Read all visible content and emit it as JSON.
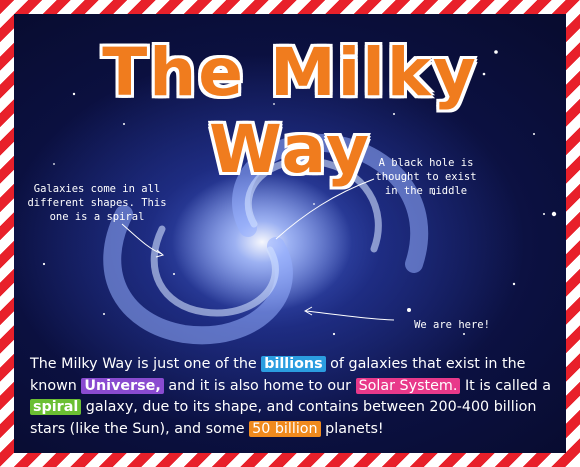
{
  "title": "The Milky Way",
  "notes": {
    "shapes": "Galaxies come in all different shapes. This one is a spiral",
    "black_hole": "A black hole is thought to exist in the middle",
    "here": "We are here!"
  },
  "body": {
    "p1": "The Milky Way is just one of the ",
    "billions": "billions",
    "p2": " of galaxies that exist in the known ",
    "universe": "Universe,",
    "p3": " and it is also home to our ",
    "solar": "Solar System.",
    "p4": " It is called a ",
    "spiral": "spiral",
    "p5": " galaxy, due to its shape, and contains between 200-400 billion stars (like the Sun), and some ",
    "fifty": "50 billion",
    "p6": " planets!"
  },
  "colors": {
    "title": "#f07c1e",
    "border_red": "#e8202a",
    "billions": "#2b9de0",
    "universe": "#8a4bd0",
    "solar": "#e8398a",
    "spiral": "#6bbf33",
    "fifty": "#f08a1e"
  }
}
